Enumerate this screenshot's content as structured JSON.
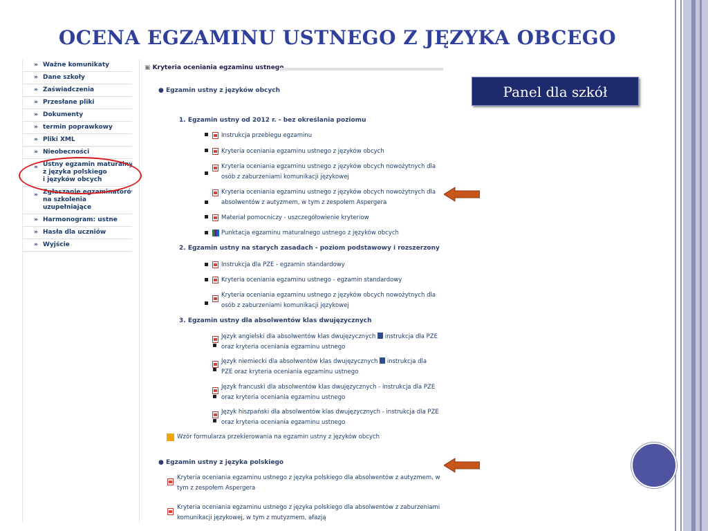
{
  "title": "OCENA EGZAMINU USTNEGO Z JĘZYKA OBCEGO",
  "panel_label": "Panel dla szkół",
  "sidebar": {
    "items": [
      {
        "label": "Ważne komunikaty"
      },
      {
        "label": "Dane szkoły"
      },
      {
        "label": "Zaświadczenia"
      },
      {
        "label": "Przesłane pliki"
      },
      {
        "label": "Dokumenty"
      },
      {
        "label": "termin poprawkowy"
      },
      {
        "label": "Pliki XML"
      },
      {
        "label": "Nieobecności"
      },
      {
        "label": "Ustny egzamin maturalny\nz języka polskiego\ni języków obcych"
      },
      {
        "label": "Zgłaszanie egzaminatorów\nna szkolenia\nuzupełniające"
      },
      {
        "label": "Harmonogram: ustne"
      },
      {
        "label": "Hasła dla uczniów"
      },
      {
        "label": "Wyjście"
      }
    ]
  },
  "content": {
    "section_header": "Kryteria oceniania egzaminu ustnego",
    "foreign": {
      "heading": "Egzamin ustny z języków obcych",
      "groups": [
        {
          "heading": "1.  Egzamin ustny od 2012 r. - bez określania poziomu",
          "items": [
            {
              "line1": "Instrukcja przebiegu egzaminu",
              "line2": ""
            },
            {
              "line1": "Kryteria oceniania egzaminu ustnego z języków obcych",
              "line2": ""
            },
            {
              "line1": "Kryteria oceniania egzaminu ustnego z języków obcych nowożytnych dla",
              "line2": "osób z zaburzeniami komunikacji językowej"
            },
            {
              "line1": "Kryteria oceniania egzaminu ustnego z języków obcych nowożytnych dla",
              "line2": "absolwentów z autyzmem, w tym z zespołem Aspergera"
            },
            {
              "line1": "Materiał pomocniczy - uszczegółowienie kryteriow",
              "line2": ""
            },
            {
              "line1": "Punktacja egzaminu maturalnego ustnego z języków obcych",
              "line2": ""
            }
          ]
        },
        {
          "heading": "2.  Egzamin ustny na starych zasadach - poziom podstawowy i rozszerzony",
          "items": [
            {
              "line1": "Instrukcja dla PZE - egzamin standardowy",
              "line2": ""
            },
            {
              "line1": "Kryteria oceniania egzaminu ustnego - egzamin standardowy",
              "line2": ""
            },
            {
              "line1": "Kryteria oceniania egzaminu ustnego z języków obcych nowożytnych dla",
              "line2": "osób z zaburzeniami komunikacji językowej"
            }
          ]
        },
        {
          "heading": "3.  Egzamin ustny dla absolwentów klas dwujęzycznych",
          "items": [
            {
              "line1": "Język angielski dla absolwentów klas dwujęzycznych",
              "line1b": "instrukcja dla PZE",
              "line2": "oraz kryteria oceniania egzaminu ustnego"
            },
            {
              "line1": "Język niemiecki dla absolwentów klas dwujęzycznych",
              "line1b": "instrukcja dla",
              "line2": "PZE oraz kryteria oceniania egzaminu ustnego"
            },
            {
              "line1": "Język francuski dla absolwentów klas dwujęzycznych - instrukcja dla PZE",
              "line2": "oraz kryteria oceniania egzaminu ustnego"
            },
            {
              "line1": "Język hiszpański dla absolwentów klas dwujęzycznych - instrukcja dla PZE",
              "line2": "oraz kryteria oceniania egzaminu ustnego"
            }
          ]
        }
      ],
      "form_link": "Wzór formularza przekierowania na egzamin ustny z języków obcych"
    },
    "polish": {
      "heading": "Egzamin ustny z języka polskiego",
      "items": [
        {
          "line1": "Kryteria oceniania egzaminu ustnego z języka polskiego dla absolwentów z autyzmem, w",
          "line2": "tym z zespołem Aspergera"
        },
        {
          "line1": "Kryteria oceniania egzaminu ustnego z języka polskiego dla absolwentów z zaburzeniami",
          "line2": "komunikacji językowej, w tym z mutyzmem, afazją"
        }
      ]
    }
  },
  "colors": {
    "title": "#2f3f9a",
    "panel_bg": "#1d2a6e",
    "arrow": "#c8561c",
    "ellipse": "#d91c1c",
    "circle": "#4e54a0"
  }
}
